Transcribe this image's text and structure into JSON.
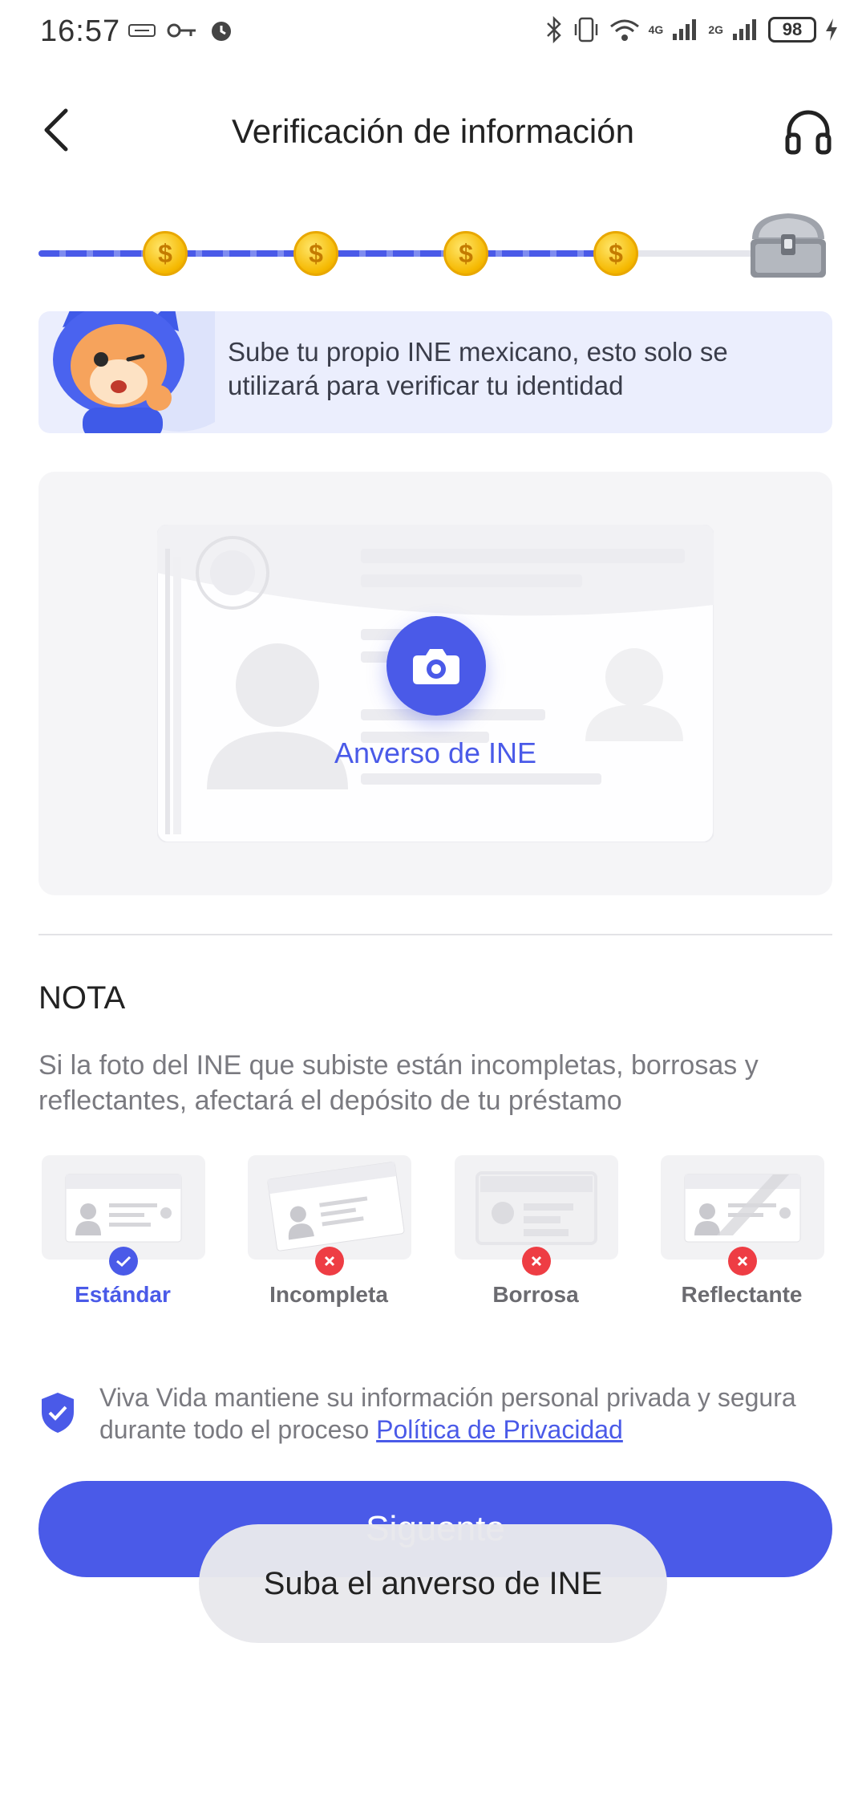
{
  "status_bar": {
    "time": "16:57",
    "battery": "98",
    "network_4g": "4G",
    "network_2g": "2G"
  },
  "header": {
    "title": "Verificación de información"
  },
  "progress": {
    "completed_steps": 4,
    "total_steps": 5
  },
  "banner": {
    "text": "Sube tu propio INE mexicano, esto solo se utilizará para verificar tu identidad"
  },
  "upload": {
    "label": "Anverso de INE"
  },
  "note": {
    "title": "NOTA",
    "text": "Si la foto del INE que subiste están incompletas, borrosas y reflectantes, afectará el depósito de tu préstamo",
    "examples": [
      {
        "label": "Estándar",
        "status": "ok"
      },
      {
        "label": "Incompleta",
        "status": "bad"
      },
      {
        "label": "Borrosa",
        "status": "bad"
      },
      {
        "label": "Reflectante",
        "status": "bad"
      }
    ]
  },
  "privacy": {
    "text": "Viva Vida mantiene su información personal privada y segura durante todo el proceso ",
    "link": "Política de Privacidad"
  },
  "button": {
    "next_label": "Siguente"
  },
  "toast": {
    "message": "Suba el anverso de INE"
  },
  "colors": {
    "accent": "#4a5ae8",
    "error": "#ee3d44",
    "coin": "#f5b800"
  }
}
